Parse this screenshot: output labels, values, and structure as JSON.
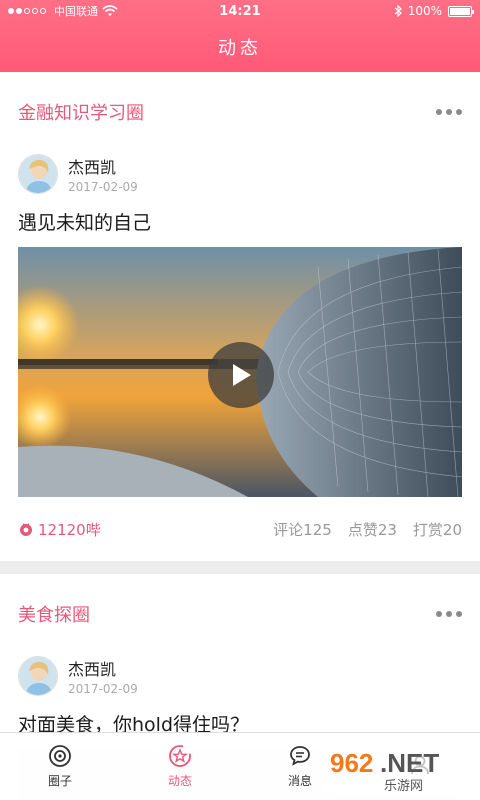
{
  "status_bar": {
    "carrier": "中国联通",
    "time": "14:21",
    "battery": "100%",
    "battery_level": 1.0
  },
  "header": {
    "title": "动态"
  },
  "posts": [
    {
      "circle": "金融知识学习圈",
      "author": "杰西凯",
      "date": "2017-02-09",
      "title": "遇见未知的自己",
      "coins": "12120哔",
      "comments": "评论125",
      "likes": "点赞23",
      "rewards": "打赏20"
    },
    {
      "circle": "美食探圈",
      "author": "杰西凯",
      "date": "2017-02-09",
      "title": "对面美食，你hold得住吗？"
    }
  ],
  "tabbar": {
    "items": [
      {
        "label": "圈子",
        "icon": "circle-icon"
      },
      {
        "label": "动态",
        "icon": "star-icon"
      },
      {
        "label": "消息",
        "icon": "chat-icon"
      },
      {
        "label": "",
        "icon": "profile-icon"
      }
    ]
  },
  "watermark": {
    "text": "962.NET",
    "subtext": "乐游网"
  },
  "colors": {
    "accent": "#e6587a",
    "header": "#ff6480"
  }
}
